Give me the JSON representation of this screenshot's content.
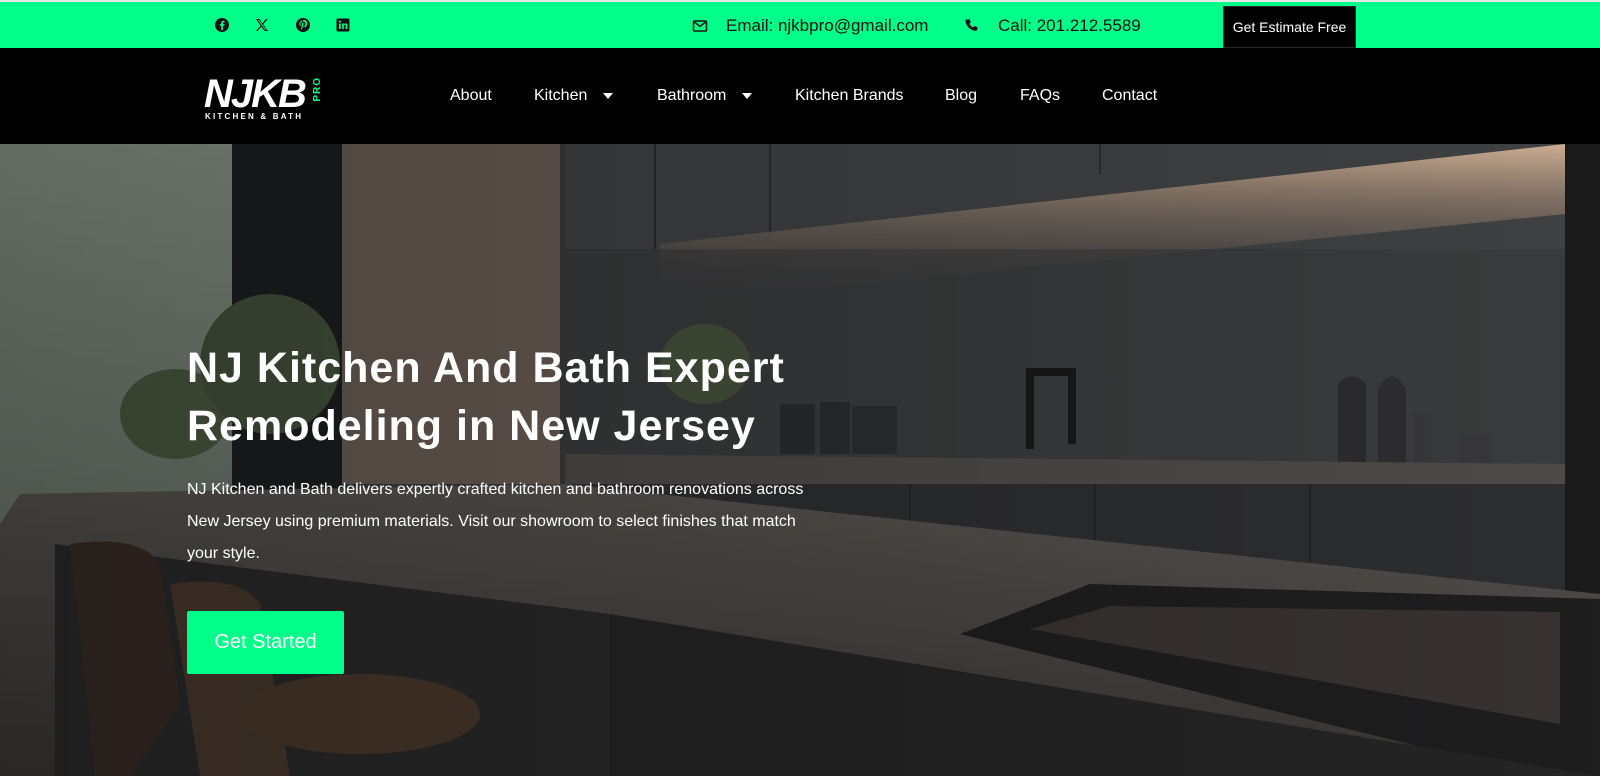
{
  "topbar": {
    "social": [
      {
        "icon": "facebook-icon"
      },
      {
        "icon": "x-twitter-icon"
      },
      {
        "icon": "pinterest-icon"
      },
      {
        "icon": "linkedin-icon"
      }
    ],
    "email_text": "Email: njkbpro@gmail.com",
    "phone_text": "Call: 201.212.5589",
    "estimate_label": "Get Estimate Free"
  },
  "logo": {
    "main": "NJKB",
    "pro": "PRO",
    "sub": "KITCHEN & BATH"
  },
  "nav": {
    "items": [
      {
        "label": "About"
      },
      {
        "label": "Kitchen"
      },
      {
        "label": "Bathroom"
      },
      {
        "label": "Kitchen Brands"
      },
      {
        "label": "Blog"
      },
      {
        "label": "FAQs"
      },
      {
        "label": "Contact"
      }
    ]
  },
  "hero": {
    "title_line1": "NJ Kitchen And Bath Expert",
    "title_line2": "Remodeling in New Jersey",
    "description": "NJ Kitchen and Bath delivers expertly crafted kitchen and bathroom renovations across New Jersey using premium materials. Visit our showroom to select finishes that match your style.",
    "cta_label": "Get Started"
  },
  "colors": {
    "accent": "#00ff88",
    "nav_background": "#000000",
    "text_light": "#ffffff"
  }
}
